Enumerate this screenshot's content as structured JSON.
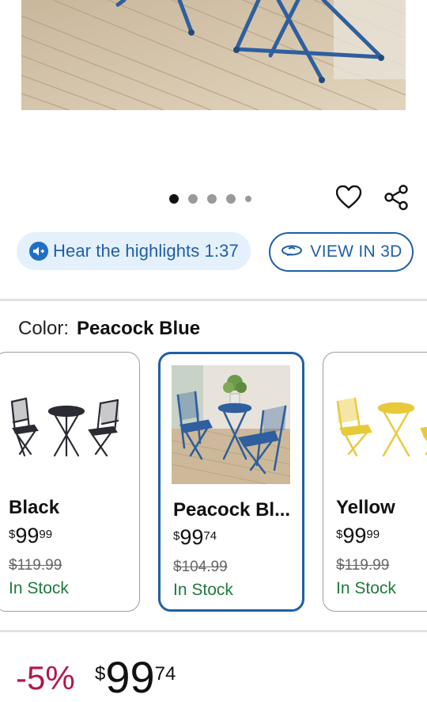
{
  "gallery": {
    "dots_count": 5,
    "active_index": 0
  },
  "actions": {
    "favorite_icon": "heart-outline-icon",
    "share_icon": "share-icon"
  },
  "highlights": {
    "label": "Hear the highlights 1:37",
    "icon": "audio-icon"
  },
  "view3d": {
    "label": "VIEW IN 3D",
    "icon": "rotate-3d-icon"
  },
  "color": {
    "label": "Color:",
    "value": "Peacock Blue"
  },
  "swatches": [
    {
      "name": "Black",
      "price_currency": "$",
      "price_dollars": "99",
      "price_cents": "99",
      "was_price": "$119.99",
      "stock": "In Stock",
      "color": "#2b2b33",
      "selected": false
    },
    {
      "name": "Peacock Bl...",
      "price_currency": "$",
      "price_dollars": "99",
      "price_cents": "74",
      "was_price": "$104.99",
      "stock": "In Stock",
      "color": "#2f5f9e",
      "selected": true
    },
    {
      "name": "Yellow",
      "price_currency": "$",
      "price_dollars": "99",
      "price_cents": "99",
      "was_price": "$119.99",
      "stock": "In Stock",
      "color": "#e8c93a",
      "selected": false
    }
  ],
  "price": {
    "discount": "-5%",
    "currency": "$",
    "dollars": "99",
    "cents": "74"
  },
  "colors": {
    "brand_blue": "#1f5fa8",
    "pill_bg": "#e4f0fb",
    "stock_green": "#1f7a3a",
    "discount_red": "#b3164b"
  }
}
